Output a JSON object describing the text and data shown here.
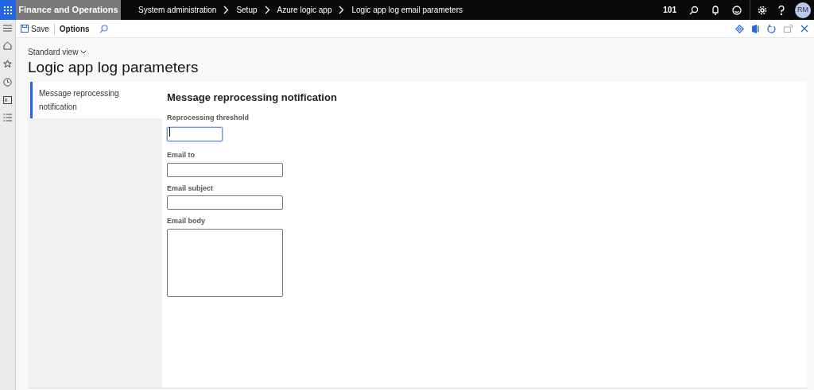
{
  "app_bar": {
    "app_name": "Finance and Operations",
    "breadcrumb": [
      "System administration",
      "Setup",
      "Azure logic app",
      "Logic app log email parameters"
    ],
    "company": "101",
    "user_initials": "RM"
  },
  "toolbar": {
    "buttons": [
      "Save",
      "Options"
    ]
  },
  "page": {
    "view": "Standard view",
    "title": "Logic app log parameters"
  },
  "sections": [
    {
      "label": "Message reprocessing notification",
      "selected": true
    }
  ],
  "form": {
    "heading": "Message reprocessing notification",
    "fields": [
      {
        "label": "Reprocessing threshold",
        "kind": "short",
        "focused": true
      },
      {
        "label": "Email to",
        "kind": "text",
        "focused": false
      },
      {
        "label": "Email subject",
        "kind": "text",
        "focused": false
      },
      {
        "label": "Email body",
        "kind": "multiline",
        "focused": false
      }
    ]
  }
}
